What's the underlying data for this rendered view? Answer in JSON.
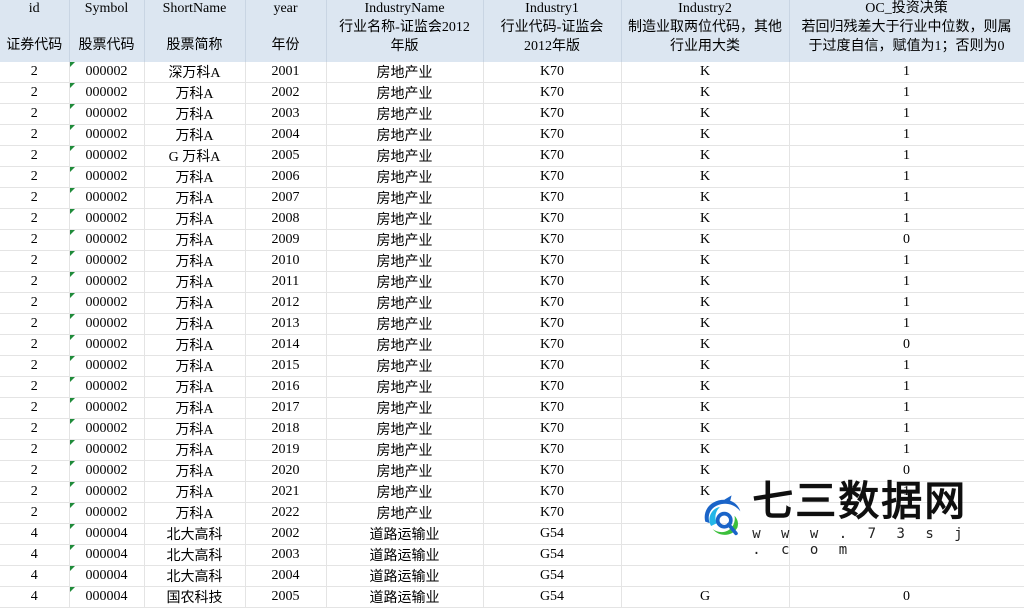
{
  "columns": [
    {
      "en": "id",
      "cn": "证券代码",
      "cn2": ""
    },
    {
      "en": "Symbol",
      "cn": "股票代码",
      "cn2": ""
    },
    {
      "en": "ShortName",
      "cn": "股票简称",
      "cn2": ""
    },
    {
      "en": "year",
      "cn": "年份",
      "cn2": ""
    },
    {
      "en": "IndustryName",
      "cn": "行业名称-证监会2012",
      "cn2": "年版"
    },
    {
      "en": "Industry1",
      "cn": "行业代码-证监会",
      "cn2": "2012年版"
    },
    {
      "en": "Industry2",
      "cn": "制造业取两位代码，其他",
      "cn2": "行业用大类"
    },
    {
      "en": "OC_投资决策",
      "cn": "若回归残差大于行业中位数，则属",
      "cn2": "于过度自信，赋值为1；否则为0"
    }
  ],
  "rows": [
    [
      "2",
      "000002",
      "深万科A",
      "2001",
      "房地产业",
      "K70",
      "K",
      "1"
    ],
    [
      "2",
      "000002",
      "万科A",
      "2002",
      "房地产业",
      "K70",
      "K",
      "1"
    ],
    [
      "2",
      "000002",
      "万科A",
      "2003",
      "房地产业",
      "K70",
      "K",
      "1"
    ],
    [
      "2",
      "000002",
      "万科A",
      "2004",
      "房地产业",
      "K70",
      "K",
      "1"
    ],
    [
      "2",
      "000002",
      "G 万科A",
      "2005",
      "房地产业",
      "K70",
      "K",
      "1"
    ],
    [
      "2",
      "000002",
      "万科A",
      "2006",
      "房地产业",
      "K70",
      "K",
      "1"
    ],
    [
      "2",
      "000002",
      "万科A",
      "2007",
      "房地产业",
      "K70",
      "K",
      "1"
    ],
    [
      "2",
      "000002",
      "万科A",
      "2008",
      "房地产业",
      "K70",
      "K",
      "1"
    ],
    [
      "2",
      "000002",
      "万科A",
      "2009",
      "房地产业",
      "K70",
      "K",
      "0"
    ],
    [
      "2",
      "000002",
      "万科A",
      "2010",
      "房地产业",
      "K70",
      "K",
      "1"
    ],
    [
      "2",
      "000002",
      "万科A",
      "2011",
      "房地产业",
      "K70",
      "K",
      "1"
    ],
    [
      "2",
      "000002",
      "万科A",
      "2012",
      "房地产业",
      "K70",
      "K",
      "1"
    ],
    [
      "2",
      "000002",
      "万科A",
      "2013",
      "房地产业",
      "K70",
      "K",
      "1"
    ],
    [
      "2",
      "000002",
      "万科A",
      "2014",
      "房地产业",
      "K70",
      "K",
      "0"
    ],
    [
      "2",
      "000002",
      "万科A",
      "2015",
      "房地产业",
      "K70",
      "K",
      "1"
    ],
    [
      "2",
      "000002",
      "万科A",
      "2016",
      "房地产业",
      "K70",
      "K",
      "1"
    ],
    [
      "2",
      "000002",
      "万科A",
      "2017",
      "房地产业",
      "K70",
      "K",
      "1"
    ],
    [
      "2",
      "000002",
      "万科A",
      "2018",
      "房地产业",
      "K70",
      "K",
      "1"
    ],
    [
      "2",
      "000002",
      "万科A",
      "2019",
      "房地产业",
      "K70",
      "K",
      "1"
    ],
    [
      "2",
      "000002",
      "万科A",
      "2020",
      "房地产业",
      "K70",
      "K",
      "0"
    ],
    [
      "2",
      "000002",
      "万科A",
      "2021",
      "房地产业",
      "K70",
      "K",
      "1"
    ],
    [
      "2",
      "000002",
      "万科A",
      "2022",
      "房地产业",
      "K70",
      "",
      ""
    ],
    [
      "4",
      "000004",
      "北大高科",
      "2002",
      "道路运输业",
      "G54",
      "",
      ""
    ],
    [
      "4",
      "000004",
      "北大高科",
      "2003",
      "道路运输业",
      "G54",
      "",
      ""
    ],
    [
      "4",
      "000004",
      "北大高科",
      "2004",
      "道路运输业",
      "G54",
      "",
      ""
    ],
    [
      "4",
      "000004",
      "国农科技",
      "2005",
      "道路运输业",
      "G54",
      "G",
      "0"
    ]
  ],
  "watermark": {
    "title": "七三数据网",
    "url": "w w w . 7 3 s j . c o m",
    "logo_colors": {
      "blue": "#1a64c8",
      "green": "#3cbf3c",
      "cyan": "#22b6e8"
    }
  },
  "colors": {
    "header_bg": "#dce6f1",
    "grid": "#e4e4e4",
    "cell_marker": "#1f8b3a"
  }
}
